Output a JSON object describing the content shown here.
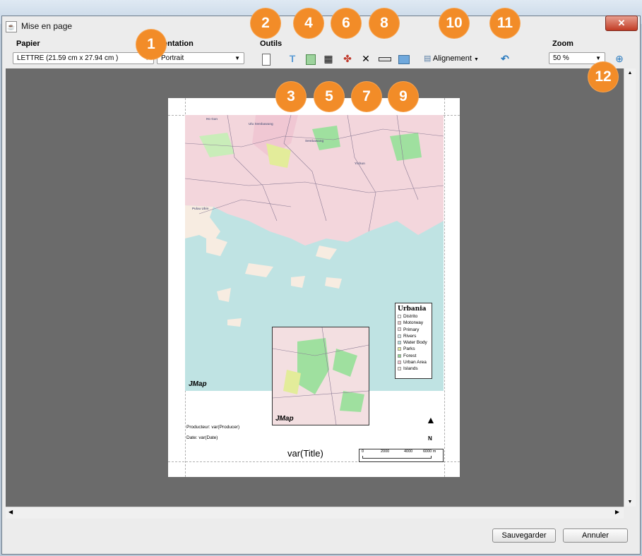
{
  "window": {
    "title": "Mise en page",
    "close_glyph": "✕",
    "app_icon": "java-icon"
  },
  "toolbar": {
    "paper_label": "Papier",
    "paper_value": "LETTRE  (21.59 cm x 27.94 cm )",
    "orientation_label": "Orientation",
    "orientation_visible_label": "ientation",
    "orientation_value": "Portrait",
    "tools_label": "Outils",
    "alignment_label": "Alignement",
    "zoom_label": "Zoom",
    "zoom_value": "50 %"
  },
  "badges": [
    "1",
    "2",
    "3",
    "4",
    "5",
    "6",
    "7",
    "8",
    "9",
    "10",
    "11",
    "12"
  ],
  "page": {
    "logo": "JMap",
    "inset_logo": "JMap",
    "north": "N",
    "producer": "Producteur:  var(Producer)",
    "date": "Date:  var(Date)",
    "title": "var(Title)",
    "scale_labels": [
      "0",
      "2000",
      "4000",
      "6000 m"
    ]
  },
  "legend": {
    "title": "Urbania",
    "items": [
      {
        "label": "Distrito",
        "color": "#ffffff"
      },
      {
        "label": "Motorway",
        "color": "#e7c9c9"
      },
      {
        "label": "Primary",
        "color": "#f1dede"
      },
      {
        "label": "Rivers",
        "color": "#d8eef0"
      },
      {
        "label": "Water Body",
        "color": "#b7dfe3"
      },
      {
        "label": "Parks",
        "color": "#e9ee9a"
      },
      {
        "label": "Forest",
        "color": "#8fd68f"
      },
      {
        "label": "Urban Area",
        "color": "#f4c6d2"
      },
      {
        "label": "Islands",
        "color": "#f7ece1"
      }
    ]
  },
  "buttons": {
    "save": "Sauvegarder",
    "cancel": "Annuler"
  },
  "colors": {
    "badge": "#f28c28",
    "map_water": "#bfe3e3",
    "map_urban": "#f3d6dc"
  }
}
